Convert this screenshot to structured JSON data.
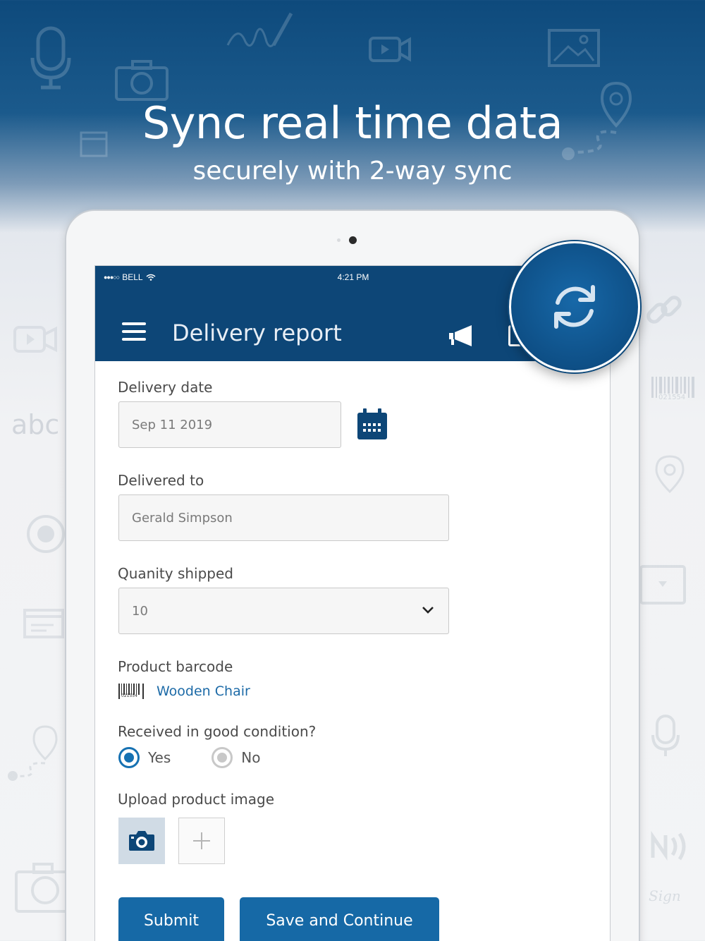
{
  "promo": {
    "headline": "Sync real time data",
    "subline": "securely with 2-way sync"
  },
  "status_bar": {
    "carrier": "BELL",
    "time": "4:21 PM"
  },
  "app_bar": {
    "title": "Delivery report",
    "menu_icon": "hamburger-icon",
    "action_icon": "megaphone-icon",
    "sync_icon": "sync-icon"
  },
  "background": {
    "abc_text": "abc",
    "barcode_number": "021554",
    "signature_text": "Sign"
  },
  "form": {
    "delivery_date": {
      "label": "Delivery date",
      "value": "Sep 11 2019",
      "icon": "calendar-icon"
    },
    "delivered_to": {
      "label": "Delivered to",
      "value": "Gerald Simpson"
    },
    "quantity_shipped": {
      "label": "Quanity shipped",
      "selected": "10"
    },
    "product_barcode": {
      "label": "Product barcode",
      "barcode_number": "021554",
      "value": "Wooden Chair"
    },
    "condition": {
      "label": "Received in good condition?",
      "options": [
        {
          "label": "Yes",
          "selected": true
        },
        {
          "label": "No",
          "selected": false
        }
      ]
    },
    "upload": {
      "label": "Upload product image"
    },
    "buttons": {
      "submit": "Submit",
      "save_continue": "Save and Continue"
    }
  },
  "colors": {
    "primary": "#0d4677",
    "accent": "#1669a6",
    "link": "#1c6aa7"
  }
}
